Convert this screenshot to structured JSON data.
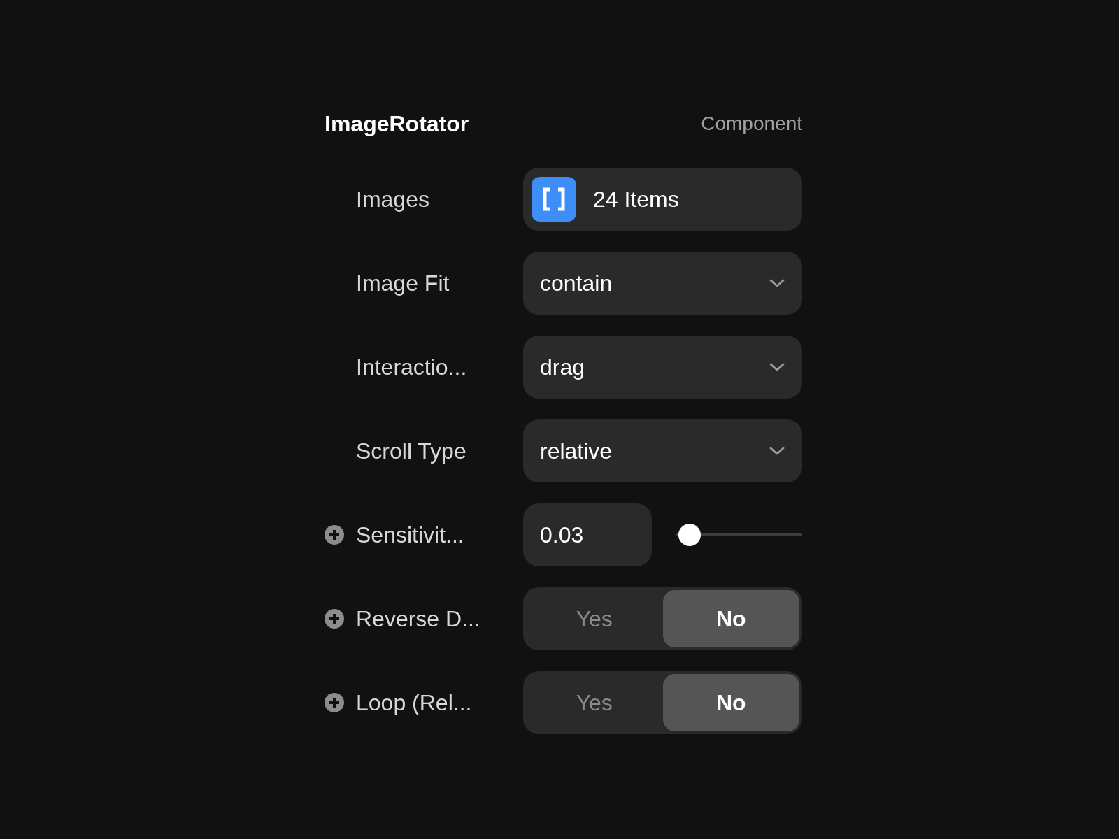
{
  "header": {
    "title": "ImageRotator",
    "subtitle": "Component"
  },
  "properties": [
    {
      "kind": "array",
      "label": "Images",
      "add_button": false,
      "value": "24 Items"
    },
    {
      "kind": "select",
      "label": "Image Fit",
      "add_button": false,
      "value": "contain"
    },
    {
      "kind": "select",
      "label": "Interactio...",
      "add_button": false,
      "value": "drag"
    },
    {
      "kind": "select",
      "label": "Scroll Type",
      "add_button": false,
      "value": "relative"
    },
    {
      "kind": "number",
      "label": "Sensitivit...",
      "add_button": true,
      "value": "0.03",
      "level": 0.03
    },
    {
      "kind": "toggle",
      "label": "Reverse D...",
      "add_button": true,
      "options": [
        {
          "label": "Yes",
          "selected": false
        },
        {
          "label": "No",
          "selected": true
        }
      ]
    },
    {
      "kind": "toggle",
      "label": "Loop (Rel...",
      "add_button": true,
      "options": [
        {
          "label": "Yes",
          "selected": false
        },
        {
          "label": "No",
          "selected": true
        }
      ]
    }
  ]
}
